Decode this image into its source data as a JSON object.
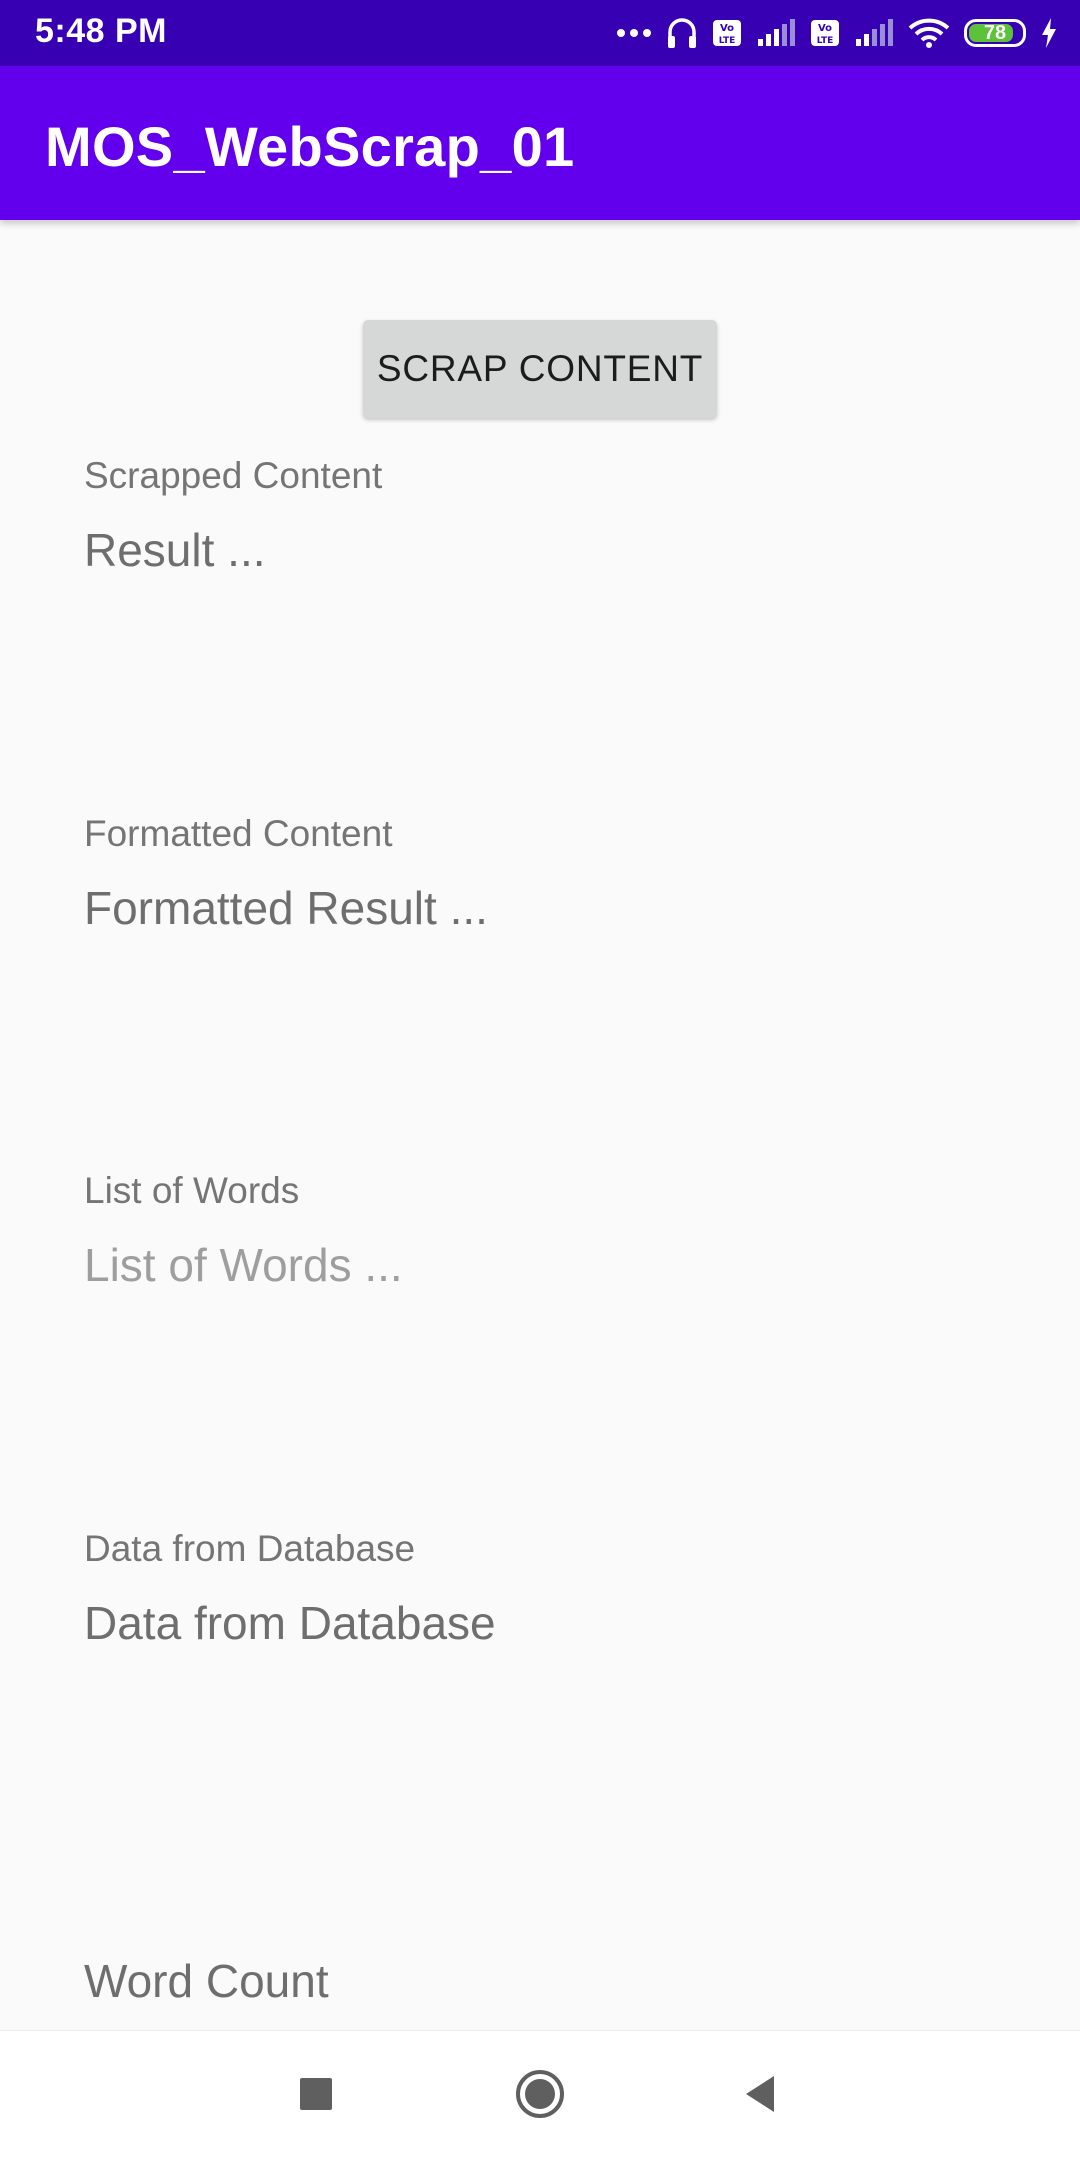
{
  "status_bar": {
    "time": "5:48 PM",
    "battery_level": "78",
    "icons": [
      "more-dots-icon",
      "headphones-icon",
      "volte-icon",
      "signal-icon",
      "volte-icon",
      "signal-icon",
      "wifi-icon",
      "battery-icon",
      "charging-icon"
    ]
  },
  "app_bar": {
    "title": "MOS_WebScrap_01"
  },
  "main": {
    "scrap_button_label": "SCRAP CONTENT",
    "sections": [
      {
        "label": "Scrapped Content",
        "value": "Result ..."
      },
      {
        "label": "Formatted Content",
        "value": "Formatted Result ..."
      },
      {
        "label": "List of Words",
        "value": "List of Words ..."
      },
      {
        "label": "Data from Database",
        "value": "Data from Database"
      }
    ],
    "word_count_label": "Word Count"
  },
  "nav_bar": {
    "icons": [
      "recents-square-icon",
      "home-circle-icon",
      "back-triangle-icon"
    ]
  },
  "colors": {
    "status_bar": "#3700b3",
    "app_bar": "#6200ee",
    "background": "#fafafa",
    "button": "#d6d7d7",
    "battery_fill": "#5bc23a"
  }
}
